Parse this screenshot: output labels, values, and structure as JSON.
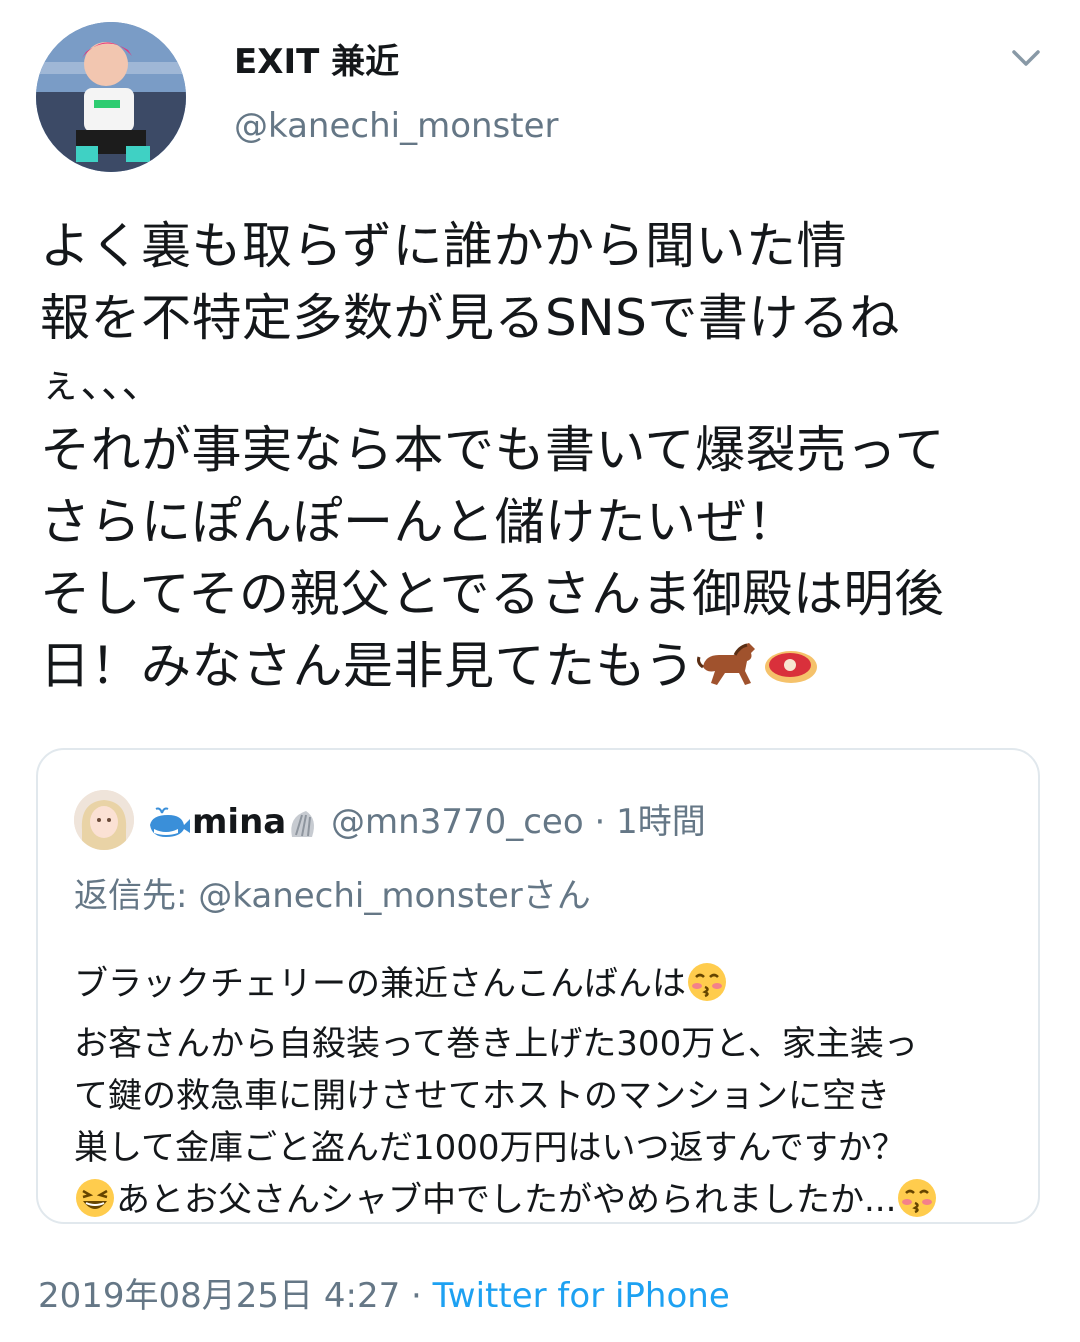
{
  "author": {
    "display_name": "EXIT 兼近",
    "handle": "@kanechi_monster"
  },
  "tweet": {
    "lines": [
      "よく裏も取らずに誰かから聞いた情",
      "報を不特定多数が見るSNSで書けるね",
      "ぇ、、、",
      "それが事実なら本でも書いて爆裂売って",
      "さらにぽんぽーんと儲けたいぜ！",
      "そしてその親父とでるさんま御殿は明後",
      "日！みなさん是非見てたもう"
    ],
    "emojis": [
      "horse-emoji",
      "meat-emoji"
    ]
  },
  "quoted_tweet": {
    "display_name": "mina",
    "handle": "@mn3770_ceo",
    "separator": "·",
    "time": "1時間",
    "reply_prefix": "返信先: ",
    "reply_to": "@kanechi_monster",
    "reply_suffix": "さん",
    "body_lines": [
      "ブラックチェリーの兼近さんこんばんは",
      "お客さんから自殺装って巻き上げた300万と、家主装っ",
      "て鍵の救急車に開けさせてホストのマンションに空き",
      "巣して金庫ごと盗んだ1000万円はいつ返すんですか？",
      "あとお父さんシャブ中でしたがやめられましたか..."
    ]
  },
  "footer": {
    "timestamp": "2019年08月25日 4:27",
    "separator": " · ",
    "source": "Twitter for iPhone"
  },
  "colors": {
    "text": "#14171a",
    "secondary": "#657786",
    "link": "#1da1f2",
    "border": "#e1e8ed"
  }
}
